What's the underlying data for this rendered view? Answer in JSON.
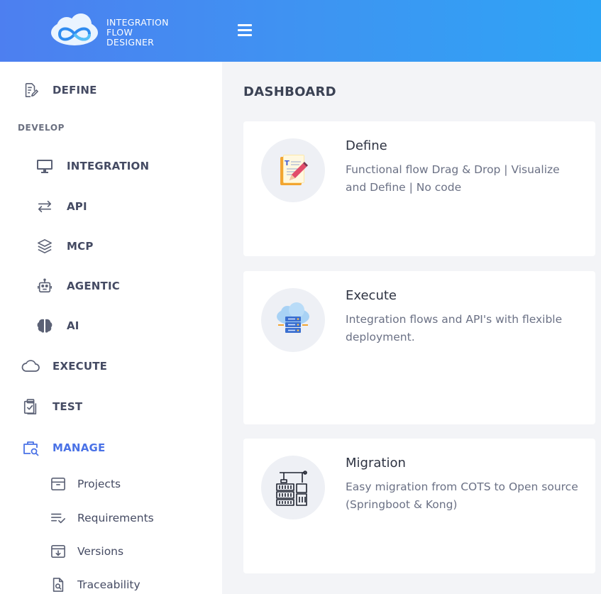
{
  "brand": {
    "line1": "INTEGRATION",
    "line2": "FLOW",
    "line3": "DESIGNER"
  },
  "colors": {
    "accent": "#4a72e6",
    "topbar_start": "#4d7ff0",
    "topbar_end": "#2ea4f5",
    "text": "#454b63"
  },
  "sidebar": {
    "define": {
      "label": "DEFINE",
      "icon": "document-edit-icon"
    },
    "section_develop": "DEVELOP",
    "develop_items": [
      {
        "label": "INTEGRATION",
        "icon": "monitor-icon"
      },
      {
        "label": "API",
        "icon": "arrows-exchange-icon"
      },
      {
        "label": "MCP",
        "icon": "layers-icon"
      },
      {
        "label": "AGENTIC",
        "icon": "robot-icon"
      },
      {
        "label": "AI",
        "icon": "brain-icon"
      }
    ],
    "execute": {
      "label": "EXECUTE",
      "icon": "cloud-icon"
    },
    "test": {
      "label": "TEST",
      "icon": "clipboard-check-icon"
    },
    "manage": {
      "label": "MANAGE",
      "icon": "briefcase-search-icon"
    },
    "manage_items": [
      {
        "label": "Projects",
        "icon": "archive-box-icon"
      },
      {
        "label": "Requirements",
        "icon": "list-check-icon"
      },
      {
        "label": "Versions",
        "icon": "archive-download-icon"
      },
      {
        "label": "Traceability",
        "icon": "file-search-icon"
      }
    ]
  },
  "main": {
    "title": "DASHBOARD",
    "cards": [
      {
        "title": "Define",
        "desc": "Functional flow Drag & Drop | Visualize and Define | No code",
        "icon": "notepad-pen-icon"
      },
      {
        "title": "Execute",
        "desc": "Integration flows and API's with flexible deployment.",
        "icon": "cloud-server-icon"
      },
      {
        "title": "Migration",
        "desc": "Easy migration from COTS to Open source (Springboot & Kong)",
        "icon": "container-crane-icon"
      }
    ]
  }
}
